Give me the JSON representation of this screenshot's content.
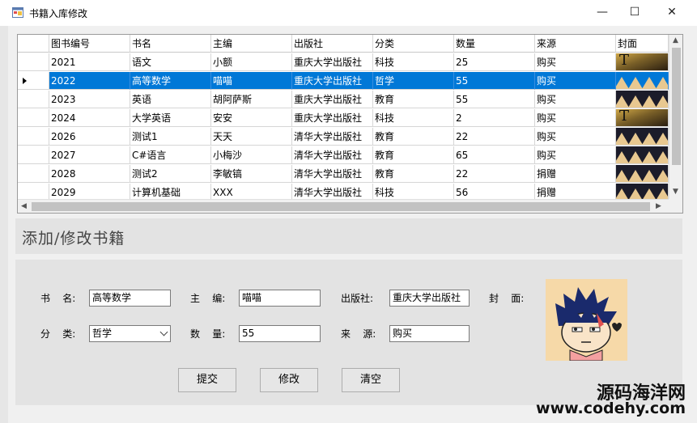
{
  "window": {
    "title": "书籍入库修改",
    "controls": {
      "minimize": "—",
      "maximize": "☐",
      "close": "✕"
    }
  },
  "grid": {
    "columns": [
      "图书编号",
      "书名",
      "主编",
      "出版社",
      "分类",
      "数量",
      "来源",
      "封面"
    ],
    "rows": [
      [
        "2021",
        "语文",
        "小额",
        "重庆大学出版社",
        "科技",
        "25",
        "购买"
      ],
      [
        "2022",
        "高等数学",
        "喵喵",
        "重庆大学出版社",
        "哲学",
        "55",
        "购买"
      ],
      [
        "2023",
        "英语",
        "胡阿萨斯",
        "重庆大学出版社",
        "教育",
        "55",
        "购买"
      ],
      [
        "2024",
        "大学英语",
        "安安",
        "重庆大学出版社",
        "科技",
        "2",
        "购买"
      ],
      [
        "2026",
        "测试1",
        "天天",
        "清华大学出版社",
        "教育",
        "22",
        "购买"
      ],
      [
        "2027",
        "C#语言",
        "小梅沙",
        "清华大学出版社",
        "教育",
        "65",
        "购买"
      ],
      [
        "2028",
        "测试2",
        "李敏镐",
        "清华大学出版社",
        "教育",
        "22",
        "捐赠"
      ],
      [
        "2029",
        "计算机基础",
        "XXX",
        "清华大学出版社",
        "科技",
        "56",
        "捐赠"
      ]
    ],
    "selected_row": 1
  },
  "section": {
    "title": "添加/修改书籍"
  },
  "form": {
    "name_label": "书    名:",
    "name_value": "高等数学",
    "editor_label": "主    编:",
    "editor_value": "喵喵",
    "publisher_label": "出版社:",
    "publisher_value": "重庆大学出版社",
    "cover_label": "封    面:",
    "category_label": "分    类:",
    "category_value": "哲学",
    "quantity_label": "数    量:",
    "quantity_value": "55",
    "source_label": "来    源:",
    "source_value": "购买"
  },
  "buttons": {
    "submit": "提交",
    "modify": "修改",
    "clear": "清空"
  },
  "watermark": {
    "line1": "源码海洋网",
    "line2": "www.codehy.com"
  }
}
